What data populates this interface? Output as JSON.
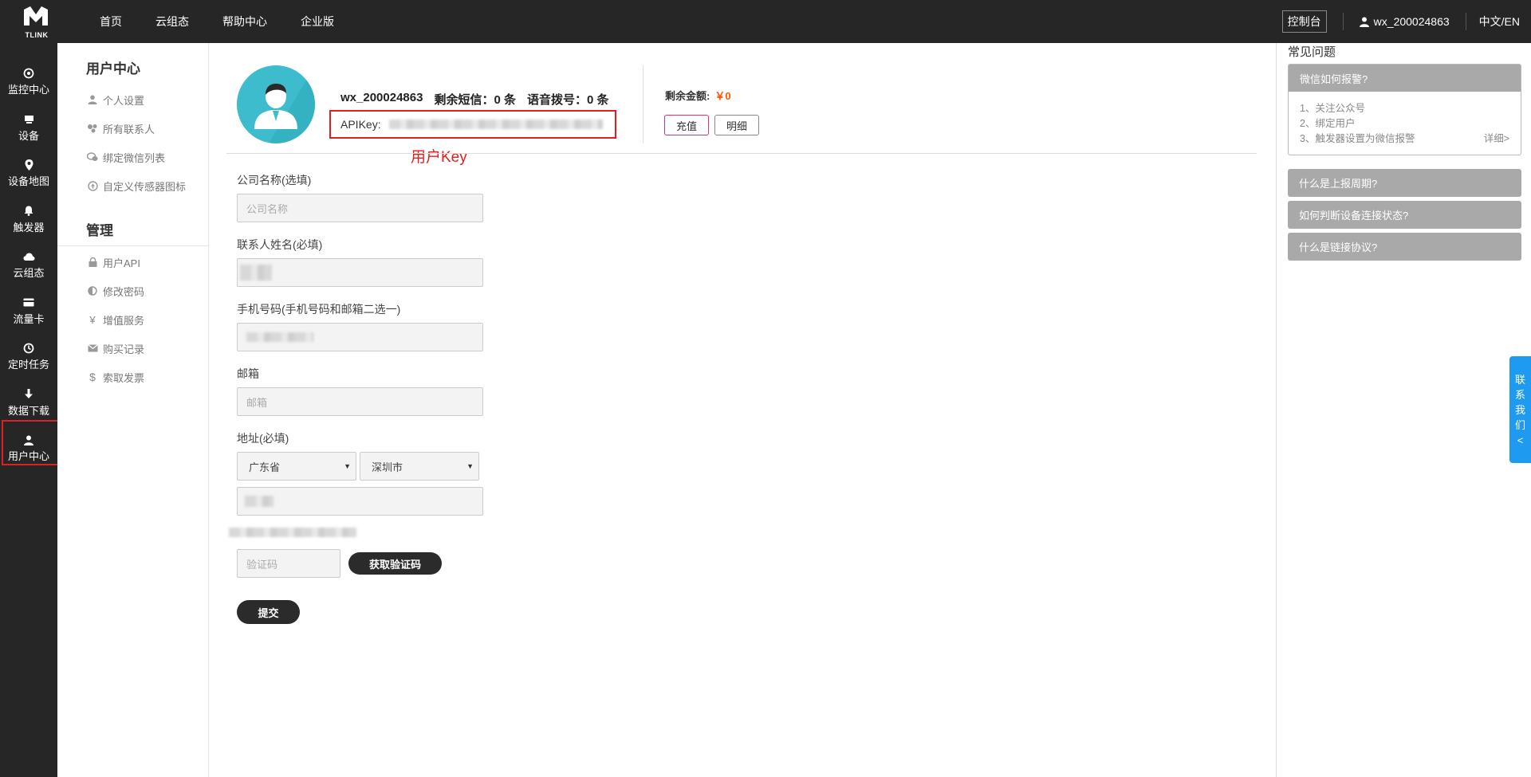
{
  "brand": {
    "logo_text": "TLINK"
  },
  "topnav": [
    "首页",
    "云组态",
    "帮助中心",
    "企业版"
  ],
  "topright": {
    "console": "控制台",
    "username": "wx_200024863",
    "lang": "中文/EN"
  },
  "iconbar": [
    {
      "label": "监控中心",
      "icon": "monitor-icon"
    },
    {
      "label": "设备",
      "icon": "device-icon"
    },
    {
      "label": "设备地图",
      "icon": "map-pin-icon"
    },
    {
      "label": "触发器",
      "icon": "bell-icon"
    },
    {
      "label": "云组态",
      "icon": "cloud-icon"
    },
    {
      "label": "流量卡",
      "icon": "card-icon"
    },
    {
      "label": "定时任务",
      "icon": "clock-icon"
    },
    {
      "label": "数据下载",
      "icon": "download-icon"
    },
    {
      "label": "用户中心",
      "icon": "user-icon"
    }
  ],
  "submenu": {
    "title1": "用户中心",
    "group1": [
      {
        "label": "个人设置",
        "icon": "person-icon"
      },
      {
        "label": "所有联系人",
        "icon": "contacts-icon"
      },
      {
        "label": "绑定微信列表",
        "icon": "wechat-icon"
      },
      {
        "label": "自定义传感器图标",
        "icon": "upload-circle-icon"
      }
    ],
    "title2": "管理",
    "group2": [
      {
        "label": "用户API",
        "icon": "lock-icon"
      },
      {
        "label": "修改密码",
        "icon": "half-circle-icon"
      },
      {
        "label": "增值服务",
        "icon": "yen-icon"
      },
      {
        "label": "购买记录",
        "icon": "envelope-icon"
      },
      {
        "label": "索取发票",
        "icon": "dollar-icon"
      }
    ]
  },
  "profile": {
    "username": "wx_200024863",
    "sms": "剩余短信：0 条",
    "voice": "语音拨号：0 条",
    "apikey_label": "APIKey:",
    "annotation": "用户Key",
    "balance_label": "剩余金额:",
    "balance_value": "￥0",
    "recharge": "充值",
    "detail": "明细"
  },
  "form": {
    "company_label": "公司名称(选填)",
    "company_placeholder": "公司名称",
    "contact_label": "联系人姓名(必填)",
    "phone_label": "手机号码(手机号码和邮箱二选一)",
    "email_label": "邮箱",
    "email_placeholder": "邮箱",
    "address_label": "地址(必填)",
    "province": "广东省",
    "city": "深圳市",
    "code_placeholder": "验证码",
    "get_code": "获取验证码",
    "submit": "提交"
  },
  "faq": {
    "title": "常见问题",
    "open_question": "微信如何报警?",
    "steps": [
      "1、关注公众号",
      "2、绑定用户",
      "3、触发器设置为微信报警"
    ],
    "more": "详细>",
    "items": [
      "什么是上报周期?",
      "如何判断设备连接状态?",
      "什么是链接协议?"
    ]
  },
  "contact_tab": [
    "联",
    "系",
    "我",
    "们",
    "<"
  ],
  "colors": {
    "dark": "#262626",
    "highlight": "#e02020",
    "accent_blue": "#1e9bf0",
    "price": "#ff5500",
    "avatar_bg": "#3cbccc"
  }
}
